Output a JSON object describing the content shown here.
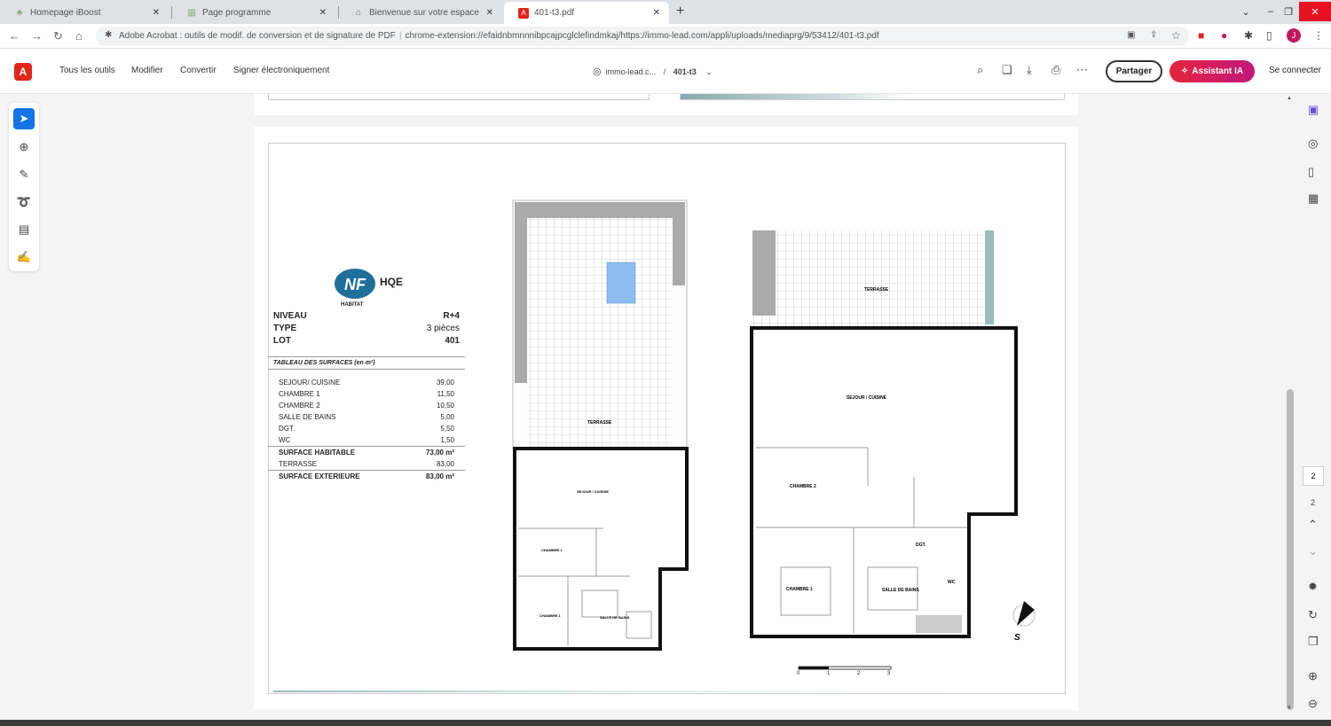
{
  "tabs": [
    {
      "title": "Homepage iBoost",
      "icon": "leaf-icon",
      "active": false
    },
    {
      "title": "Page programme",
      "icon": "building-icon",
      "active": false
    },
    {
      "title": "Bienvenue sur votre espace parti",
      "icon": "bank-icon",
      "active": false
    },
    {
      "title": "401-t3.pdf",
      "icon": "pdf-icon",
      "active": true
    }
  ],
  "address": {
    "site_name": "Adobe Acrobat : outils de modif. de conversion et de signature de PDF",
    "separator": "|",
    "url": "chrome-extension://efaidnbmnnnibpcajpcglclefindmkaj/https://immo-lead.com/appli/uploads/mediaprg/9/53412/401-t3.pdf"
  },
  "acrobat": {
    "menu": [
      "Tous les outils",
      "Modifier",
      "Convertir",
      "Signer électroniquement"
    ],
    "breadcrumb_domain": "immo-lead.c...",
    "breadcrumb_sep": "/",
    "breadcrumb_file": "401-t3",
    "share_label": "Partager",
    "ai_label": "Assistant IA",
    "login_label": "Se connecter"
  },
  "page_nav": {
    "current": "2",
    "total": "2"
  },
  "legend": {
    "niveau_label": "NIVEAU",
    "niveau_value": "R+4",
    "type_label": "TYPE",
    "type_value": "3 pièces",
    "lot_label": "LOT",
    "lot_value": "401",
    "table_title": "TABLEAU DES SURFACES (en m²)",
    "rows": [
      {
        "label": "SEJOUR/ CUISINE",
        "value": "39,00",
        "bold": false
      },
      {
        "label": "CHAMBRE 1",
        "value": "11,50",
        "bold": false
      },
      {
        "label": "CHAMBRE 2",
        "value": "10,50",
        "bold": false
      },
      {
        "label": "SALLE DE BAINS",
        "value": "5,00",
        "bold": false
      },
      {
        "label": "DGT.",
        "value": "5,50",
        "bold": false
      },
      {
        "label": "WC",
        "value": "1,50",
        "bold": false
      },
      {
        "label": "SURFACE HABITABLE",
        "value": "73,00 m²",
        "bold": true
      },
      {
        "label": "TERRASSE",
        "value": "83,00",
        "bold": false
      },
      {
        "label": "SURFACE EXTERIEURE",
        "value": "83,00 m²",
        "bold": true
      }
    ]
  },
  "nf_logo": {
    "nf": "NF",
    "hqe": "HQE",
    "sub": "HABITAT"
  },
  "plan_labels": {
    "terrasse": "TERRASSE",
    "sejour": "SEJOUR / CUISINE",
    "chambre1": "CHAMBRE 1",
    "chambre2": "CHAMBRE 2",
    "sdb": "SALLE DE BAINS",
    "dgt": "DGT.",
    "wc": "WC",
    "compass": "S"
  },
  "scale_labels": [
    "0",
    "1",
    "2",
    "3"
  ]
}
